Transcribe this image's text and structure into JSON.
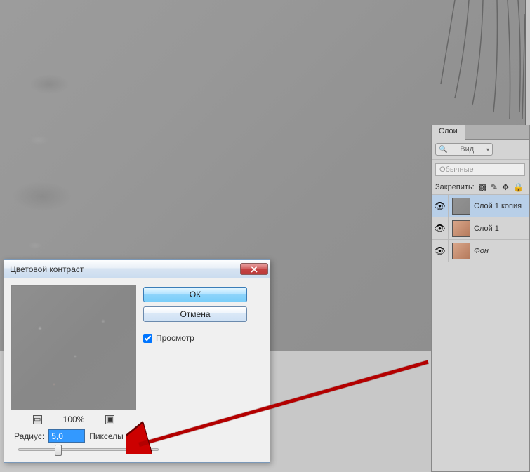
{
  "dialog": {
    "title": "Цветовой контраст",
    "ok": "ОК",
    "cancel": "Отмена",
    "preview_label": "Просмотр",
    "preview_checked": true,
    "zoom": "100%",
    "radius_label": "Радиус:",
    "radius_value": "5,0",
    "radius_unit": "Пикселы"
  },
  "layers_panel": {
    "tab": "Слои",
    "kind_label": "Вид",
    "blend_mode": "Обычные",
    "lock_label": "Закрепить:",
    "layers": [
      {
        "name": "Слой 1 копия",
        "selected": true,
        "thumb": "gray",
        "italic": false
      },
      {
        "name": "Слой 1",
        "selected": false,
        "thumb": "skin",
        "italic": false
      },
      {
        "name": "Фон",
        "selected": false,
        "thumb": "skin",
        "italic": true
      }
    ]
  }
}
